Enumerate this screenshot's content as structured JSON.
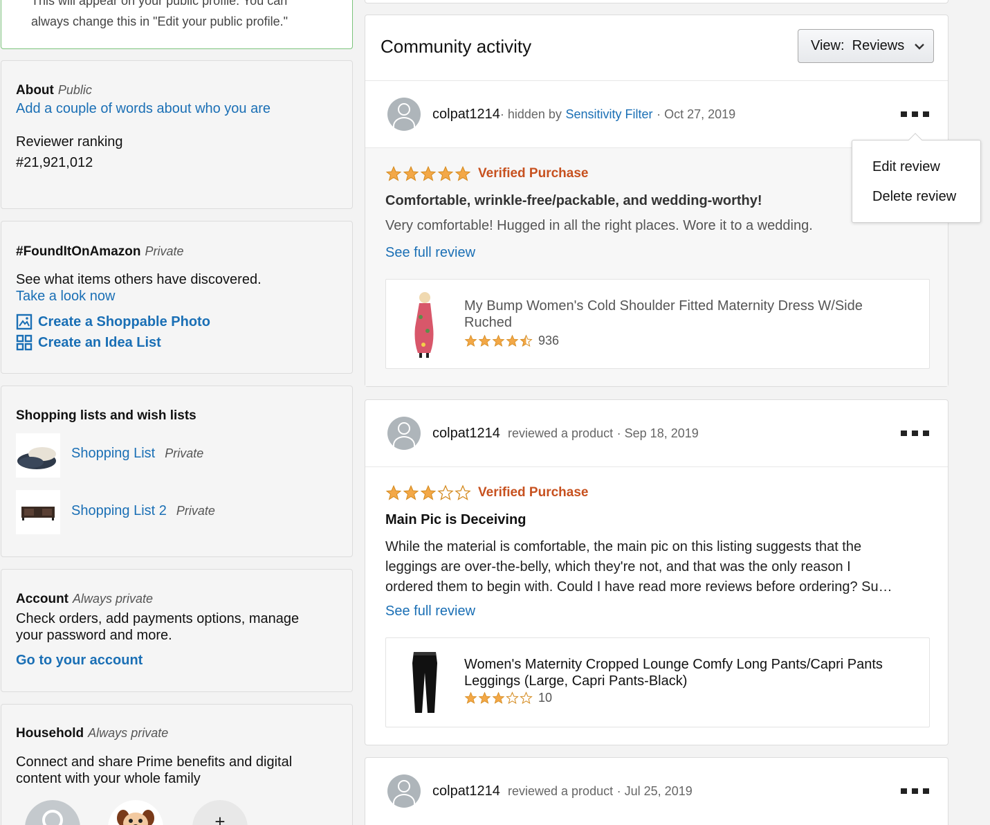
{
  "profile_note": {
    "line1": "This will appear on your public profile. You can",
    "line2": "always change this in \"Edit your public profile.\""
  },
  "about": {
    "title": "About",
    "visibility": "Public",
    "add_link": "Add a couple of words about who you are",
    "ranking_label": "Reviewer ranking",
    "ranking_value": "#21,921,012"
  },
  "found": {
    "title": "#FoundItOnAmazon",
    "visibility": "Private",
    "text": "See what items others have discovered.",
    "take_look": "Take a look now",
    "shoppable": "Create a Shoppable Photo",
    "idea": "Create an Idea List"
  },
  "lists": {
    "title": "Shopping lists and wish lists",
    "items": [
      {
        "label": "Shopping List",
        "visibility": "Private",
        "thumb": "slipper-image"
      },
      {
        "label": "Shopping List 2",
        "visibility": "Private",
        "thumb": "tv-stand-image"
      }
    ]
  },
  "account": {
    "title": "Account",
    "visibility": "Always private",
    "text1": "Check orders, add payments options, manage",
    "text2": "your password and more.",
    "link": "Go to your account"
  },
  "household": {
    "title": "Household",
    "visibility": "Always private",
    "text1": "Connect and share Prime benefits and digital",
    "text2": "content with your whole family"
  },
  "community": {
    "title": "Community activity",
    "view_label": "View:",
    "view_value": "Reviews"
  },
  "menu": {
    "edit": "Edit review",
    "delete": "Delete review"
  },
  "reviews": [
    {
      "user": "colpat1214",
      "action_pre": "· hidden by",
      "filter": "Sensitivity Filter",
      "date": "· Oct 27, 2019",
      "rating": 5,
      "verified": "Verified Purchase",
      "title": "Comfortable, wrinkle-free/packable, and wedding-worthy!",
      "body": [
        "Very comfortable! Hugged in all the right places. Wore it to a wedding."
      ],
      "see_full": "See full review",
      "product": {
        "name1": "My Bump Women's Cold Shoulder Fitted Maternity Dress W/Side",
        "name2": "Ruched",
        "rating": 4.5,
        "count": "936"
      }
    },
    {
      "user": "colpat1214",
      "action": "reviewed a product",
      "date": "· Sep 18, 2019",
      "rating": 3,
      "verified": "Verified Purchase",
      "title": "Main Pic is Deceiving",
      "body": [
        "While the material is comfortable, the main pic on this listing suggests that the",
        "leggings are over-the-belly, which they're not, and that was the only reason I",
        "ordered them to begin with. Could I have read more reviews before ordering? Su…"
      ],
      "see_full": "See full review",
      "product": {
        "name1": "Women's Maternity Cropped Lounge Comfy Long Pants/Capri Pants",
        "name2": "Leggings (Large, Capri Pants-Black)",
        "rating": 3,
        "count": "10"
      }
    },
    {
      "user": "colpat1214",
      "action": "reviewed a product",
      "date": "· Jul 25, 2019"
    }
  ],
  "colors": {
    "link": "#1a6fb5",
    "verified": "#c7511f",
    "star": "#f3a847"
  }
}
